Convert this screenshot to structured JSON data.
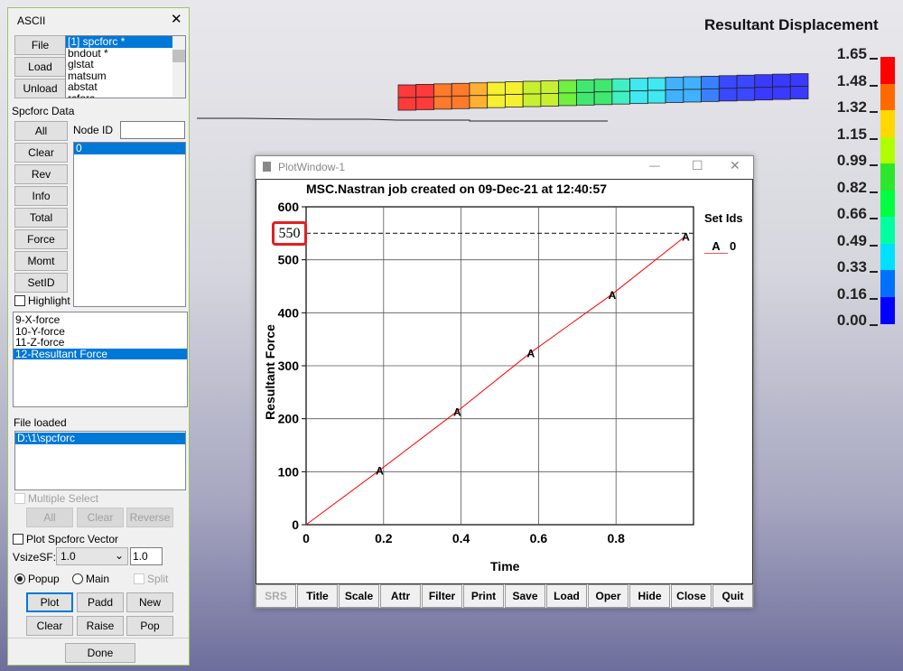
{
  "viewport": {
    "legend_title": "Resultant Displacement",
    "legend_values": [
      "1.65",
      "1.48",
      "1.32",
      "1.15",
      "0.99",
      "0.82",
      "0.66",
      "0.49",
      "0.33",
      "0.16",
      "0.00"
    ],
    "legend_colors": [
      "#ff0000",
      "#ff6a00",
      "#ffd800",
      "#b0ff00",
      "#2ee62e",
      "#00ff40",
      "#00ffa0",
      "#00e0ff",
      "#0070ff",
      "#0000ff"
    ]
  },
  "ascii": {
    "title": "ASCII",
    "close": "✕",
    "file_btn": "File",
    "load_btn": "Load",
    "unload_btn": "Unload",
    "files": [
      "[1] spcforc *",
      "bndout *",
      "glstat",
      "matsum",
      "abstat",
      "rcforc"
    ],
    "section": "Spcforc Data",
    "node_label": "Node ID",
    "node_value": "",
    "buttons": [
      "All",
      "Clear",
      "Rev",
      "Info",
      "Total",
      "Force",
      "Momt",
      "SetID"
    ],
    "highlight": "Highlight",
    "nodes": [
      "0"
    ],
    "components": [
      "9-X-force",
      "10-Y-force",
      "11-Z-force",
      "12-Resultant Force"
    ],
    "file_loaded_label": "File loaded",
    "files_loaded": [
      "D:\\1\\spcforc"
    ],
    "multiple_select": "Multiple Select",
    "ms_all": "All",
    "ms_clear": "Clear",
    "ms_reverse": "Reverse",
    "plot_vector": "Plot Spcforc Vector",
    "vsize_label": "VsizeSF:",
    "vsize_select": "1.0",
    "vsize_value": "1.0",
    "popup": "Popup",
    "main": "Main",
    "split": "Split",
    "plot": "Plot",
    "padd": "Padd",
    "new": "New",
    "clear": "Clear",
    "raise": "Raise",
    "pop": "Pop",
    "done": "Done"
  },
  "plot_window": {
    "title": "PlotWindow-1",
    "minimize": "—",
    "maximize": "☐",
    "close": "✕",
    "toolbar": [
      "SRS",
      "Title",
      "Scale",
      "Attr",
      "Filter",
      "Print",
      "Save",
      "Load",
      "Oper",
      "Hide",
      "Close",
      "Quit"
    ],
    "legend_title": "Set Ids",
    "legend_entry_marker": "A",
    "legend_entry_id": "0",
    "highlight_label": "550"
  },
  "chart_data": {
    "type": "line",
    "title": "MSC.Nastran job created on 09-Dec-21 at 12:40:57",
    "xlabel": "Time",
    "ylabel": "Resultant Force",
    "xlim": [
      0,
      1.0
    ],
    "ylim": [
      0,
      600
    ],
    "xticks": [
      "0",
      "0.2",
      "0.4",
      "0.6",
      "0.8"
    ],
    "xtick_values": [
      0,
      0.2,
      0.4,
      0.6,
      0.8
    ],
    "yticks": [
      "0",
      "100",
      "200",
      "300",
      "400",
      "500",
      "600"
    ],
    "ytick_values": [
      0,
      100,
      200,
      300,
      400,
      500,
      600
    ],
    "grid": true,
    "series": [
      {
        "name": "0",
        "marker": "A",
        "color": "#ff0000",
        "x": [
          0,
          0.19,
          0.39,
          0.58,
          0.79,
          0.98
        ],
        "y": [
          0,
          103,
          214,
          325,
          435,
          545
        ]
      }
    ],
    "reference_line": {
      "y": 550,
      "style": "dashed"
    },
    "legend": "right"
  }
}
